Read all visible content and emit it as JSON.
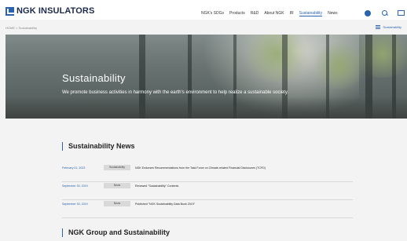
{
  "header": {
    "logo": "NGK INSULATORS",
    "nav": [
      "NGK's SDGs",
      "Products",
      "R&D",
      "About NGK",
      "IR",
      "Sustainability",
      "News"
    ],
    "active_nav": "Sustainability",
    "icons": [
      "globe-icon",
      "search-icon",
      "mail-icon"
    ]
  },
  "breadcrumb": "HOME > Sustainability",
  "submenu_label": "Sustainability",
  "hero": {
    "title": "Sustainability",
    "text": "We promote business activities in harmony with the earth's environment to help realize a sustainable society."
  },
  "news": {
    "heading": "Sustainability News",
    "items": [
      {
        "date": "February 01, 2023",
        "tag": "Sustainability",
        "title": "NGK Endorses Recommendations from the Task Force on Climate-related Financial Disclosures (TCFD)"
      },
      {
        "date": "September 30, 2019",
        "tag": "News",
        "title": "Renewed \"Sustainability\" Contents"
      },
      {
        "date": "September 30, 2019",
        "tag": "News",
        "title": "Published \"NGK Sustainability Data Book 2019\""
      }
    ]
  },
  "group_heading": "NGK Group and Sustainability",
  "colors": {
    "accent": "#2a64b0",
    "background": "#f3f3f3"
  }
}
